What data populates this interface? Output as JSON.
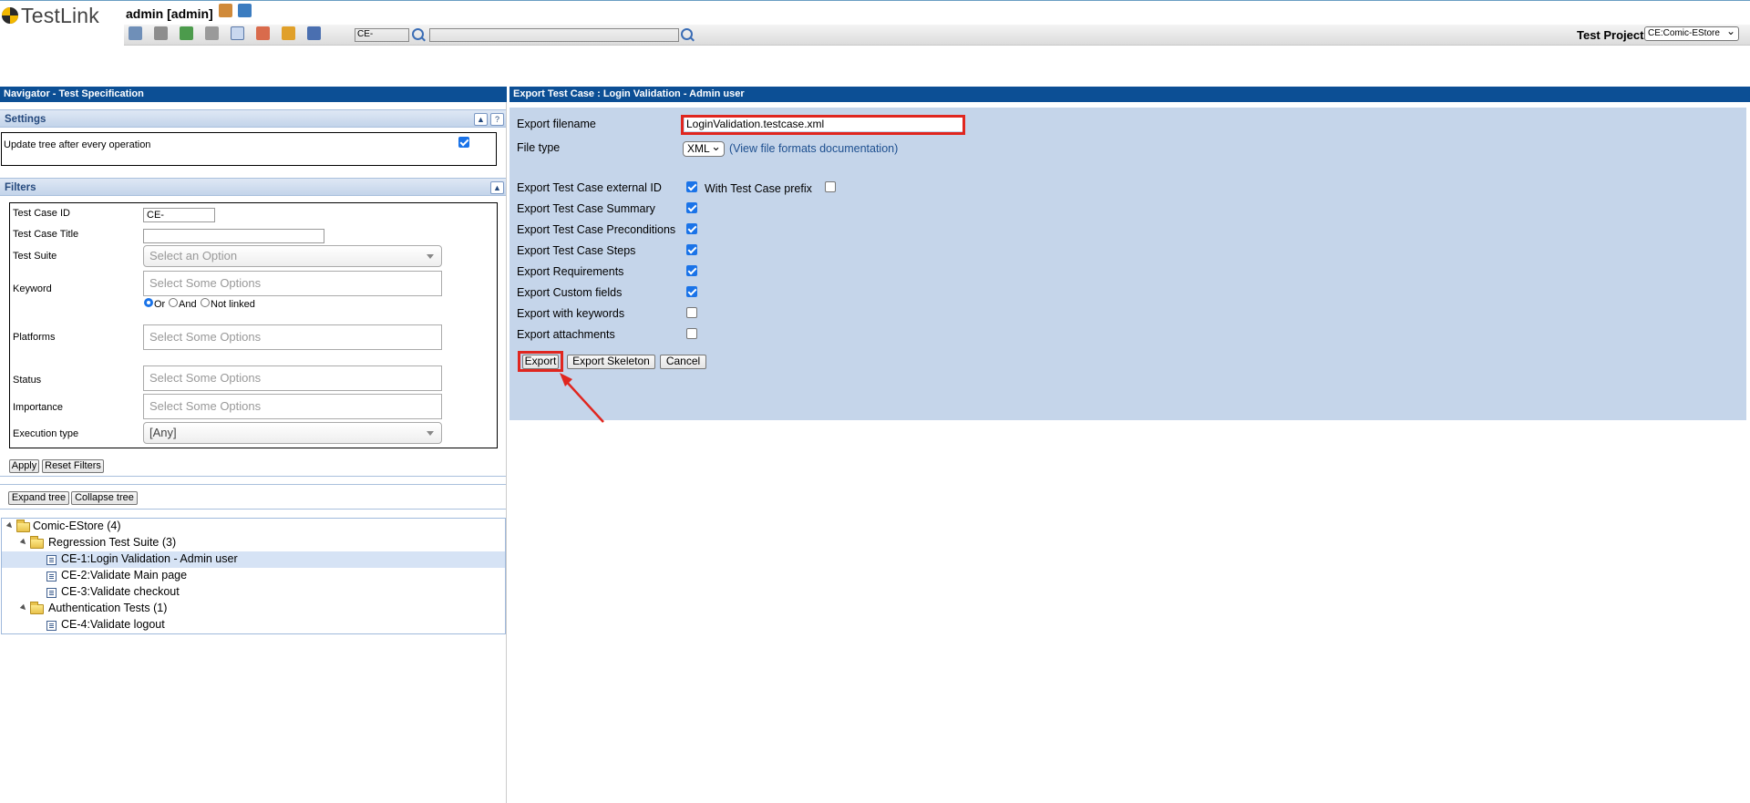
{
  "header": {
    "logo_text": "TestLink",
    "user": "admin [admin]",
    "tc_id_value": "CE-",
    "search_value": "",
    "project_label": "Test Project",
    "project_value": "CE:Comic-EStore"
  },
  "left": {
    "bar_title": "Navigator - Test Specification",
    "settings_title": "Settings",
    "settings_help_glyph": "?",
    "update_tree_label": "Update tree after every operation",
    "update_tree_checked": true,
    "filters_title": "Filters",
    "filters": {
      "tc_id_label": "Test Case ID",
      "tc_id_value": "CE-",
      "tc_title_label": "Test Case Title",
      "tc_title_value": "",
      "suite_label": "Test Suite",
      "suite_value": "Select an Option",
      "keyword_label": "Keyword",
      "keyword_placeholder": "Select Some Options",
      "radio_or": "Or",
      "radio_and": "And",
      "radio_not_linked": "Not linked",
      "radio_selected": "Or",
      "platforms_label": "Platforms",
      "platforms_placeholder": "Select Some Options",
      "status_label": "Status",
      "status_placeholder": "Select Some Options",
      "importance_label": "Importance",
      "importance_placeholder": "Select Some Options",
      "exec_type_label": "Execution type",
      "exec_type_value": "[Any]"
    },
    "apply_button": "Apply",
    "reset_button": "Reset Filters",
    "expand_button": "Expand tree",
    "collapse_button": "Collapse tree",
    "tree": [
      {
        "label": "Comic-EStore (4)",
        "type": "project"
      },
      {
        "label": "Regression Test Suite (3)",
        "type": "suite"
      },
      {
        "label": "CE-1:Login Validation - Admin user",
        "type": "case",
        "selected": true
      },
      {
        "label": "CE-2:Validate Main page",
        "type": "case"
      },
      {
        "label": "CE-3:Validate checkout",
        "type": "case"
      },
      {
        "label": "Authentication Tests (1)",
        "type": "suite"
      },
      {
        "label": "CE-4:Validate logout",
        "type": "case"
      }
    ]
  },
  "right": {
    "bar_title": "Export Test Case : Login Validation - Admin user",
    "filename_label": "Export filename",
    "filename_value": "LoginValidation.testcase.xml",
    "filetype_label": "File type",
    "filetype_value": "XML",
    "filetype_link": "(View file formats documentation)",
    "options": [
      {
        "label": "Export Test Case external ID",
        "checked": true
      },
      {
        "label": "Export Test Case Summary",
        "checked": true
      },
      {
        "label": "Export Test Case Preconditions",
        "checked": true
      },
      {
        "label": "Export Test Case Steps",
        "checked": true
      },
      {
        "label": "Export Requirements",
        "checked": true
      },
      {
        "label": "Export Custom fields",
        "checked": true
      },
      {
        "label": "Export with keywords",
        "checked": false
      },
      {
        "label": "Export attachments",
        "checked": false
      }
    ],
    "prefix_label": "With Test Case prefix",
    "prefix_checked": false,
    "export_button": "Export",
    "export_skeleton_button": "Export Skeleton",
    "cancel_button": "Cancel"
  },
  "colors": {
    "nav_bar": "#0c4f95",
    "form_bg": "#c5d5ea",
    "highlight": "#e0261f",
    "link": "#1d4f8f",
    "checkbox": "#1a73e8"
  }
}
